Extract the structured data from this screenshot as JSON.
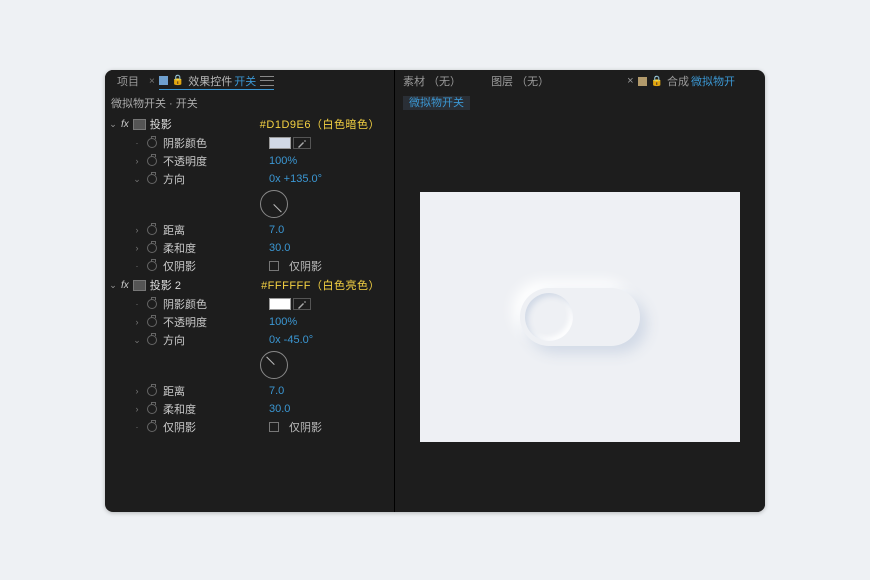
{
  "left_tabs": {
    "project": "项目",
    "effect_controls_prefix": "效果控件",
    "effect_controls_active": "开关"
  },
  "breadcrumb": "微拟物开关 · 开关",
  "effects": [
    {
      "name": "投影",
      "annotation": "#D1D9E6（白色暗色）",
      "swatch": "#d1d9e6",
      "props": {
        "shadow_color_label": "阴影颜色",
        "opacity_label": "不透明度",
        "opacity_value": "100%",
        "direction_label": "方向",
        "direction_value": "0x +135.0°",
        "dial_angle": 135,
        "distance_label": "距离",
        "distance_value": "7.0",
        "softness_label": "柔和度",
        "softness_value": "30.0",
        "only_shadow_label": "仅阴影",
        "only_shadow_chk": "仅阴影"
      }
    },
    {
      "name": "投影 2",
      "annotation": "#FFFFFF（白色亮色）",
      "swatch": "#ffffff",
      "props": {
        "shadow_color_label": "阴影颜色",
        "opacity_label": "不透明度",
        "opacity_value": "100%",
        "direction_label": "方向",
        "direction_value": "0x -45.0°",
        "dial_angle": -45,
        "distance_label": "距离",
        "distance_value": "7.0",
        "softness_label": "柔和度",
        "softness_value": "30.0",
        "only_shadow_label": "仅阴影",
        "only_shadow_chk": "仅阴影"
      }
    }
  ],
  "right_tabs": {
    "footage": "素材 （无）",
    "layer": "图层 （无）",
    "comp_prefix": "合成",
    "comp_name": "微拟物开"
  },
  "right_sub": "微拟物开关"
}
